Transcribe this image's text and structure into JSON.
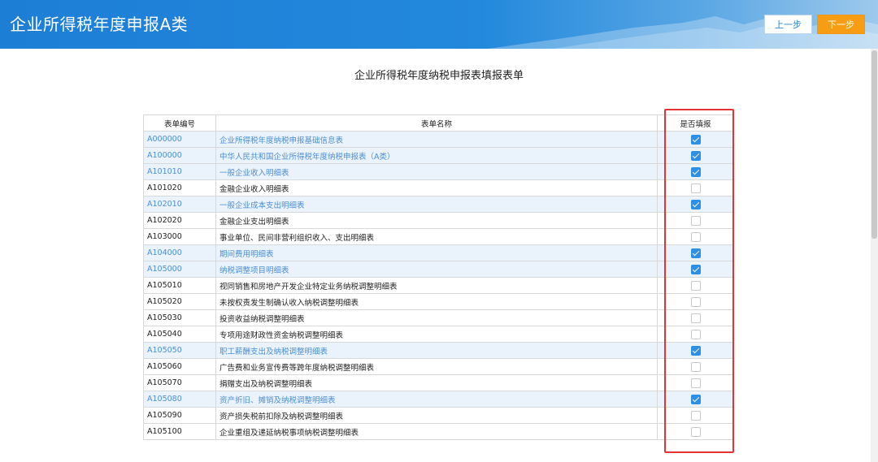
{
  "header": {
    "title": "企业所得税年度申报A类",
    "prev_label": "上一步",
    "next_label": "下一步"
  },
  "form_title": "企业所得税年度纳税申报表填报表单",
  "table": {
    "headers": {
      "code": "表单编号",
      "name": "表单名称",
      "fill": "是否填报"
    },
    "rows": [
      {
        "code": "A000000",
        "name": "企业所得税年度纳税申报基础信息表",
        "checked": true
      },
      {
        "code": "A100000",
        "name": "中华人民共和国企业所得税年度纳税申报表（A类）",
        "checked": true
      },
      {
        "code": "A101010",
        "name": "一般企业收入明细表",
        "checked": true
      },
      {
        "code": "A101020",
        "name": "金融企业收入明细表",
        "checked": false
      },
      {
        "code": "A102010",
        "name": "一般企业成本支出明细表",
        "checked": true
      },
      {
        "code": "A102020",
        "name": "金融企业支出明细表",
        "checked": false
      },
      {
        "code": "A103000",
        "name": "事业单位、民间非营利组织收入、支出明细表",
        "checked": false
      },
      {
        "code": "A104000",
        "name": "期间费用明细表",
        "checked": true
      },
      {
        "code": "A105000",
        "name": "纳税调整项目明细表",
        "checked": true
      },
      {
        "code": "A105010",
        "name": "视同销售和房地产开发企业特定业务纳税调整明细表",
        "checked": false
      },
      {
        "code": "A105020",
        "name": "未按权责发生制确认收入纳税调整明细表",
        "checked": false
      },
      {
        "code": "A105030",
        "name": "投资收益纳税调整明细表",
        "checked": false
      },
      {
        "code": "A105040",
        "name": "专项用途财政性资金纳税调整明细表",
        "checked": false
      },
      {
        "code": "A105050",
        "name": "职工薪酬支出及纳税调整明细表",
        "checked": true
      },
      {
        "code": "A105060",
        "name": "广告费和业务宣传费等跨年度纳税调整明细表",
        "checked": false
      },
      {
        "code": "A105070",
        "name": "捐赠支出及纳税调整明细表",
        "checked": false
      },
      {
        "code": "A105080",
        "name": "资产折旧、摊销及纳税调整明细表",
        "checked": true
      },
      {
        "code": "A105090",
        "name": "资产损失税前扣除及纳税调整明细表",
        "checked": false
      },
      {
        "code": "A105100",
        "name": "企业重组及递延纳税事项纳税调整明细表",
        "checked": false
      }
    ]
  },
  "colors": {
    "header_blue": "#1d7ed6",
    "next_button": "#f79d13",
    "checked_row_text": "#4b8ed6",
    "checked_row_bg": "#eaf3fb",
    "checkbox_on": "#2d8fe5",
    "highlight_border": "#e53333"
  }
}
